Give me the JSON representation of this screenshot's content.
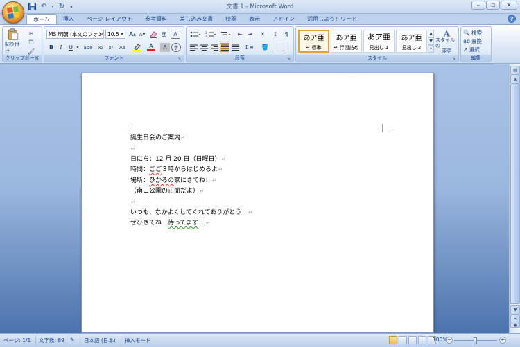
{
  "window": {
    "title": "文書 1 - Microsoft Word"
  },
  "quick_access": {
    "icons": [
      "save-icon",
      "undo-icon",
      "redo-icon",
      "customize-icon"
    ]
  },
  "tabs": [
    {
      "label": "ホーム",
      "active": true
    },
    {
      "label": "挿入"
    },
    {
      "label": "ページ レイアウト"
    },
    {
      "label": "参考資料"
    },
    {
      "label": "差し込み文書"
    },
    {
      "label": "校閲"
    },
    {
      "label": "表示"
    },
    {
      "label": "アドイン"
    },
    {
      "label": "活用しよう！ワード"
    }
  ],
  "ribbon": {
    "clipboard": {
      "label": "クリップボード",
      "paste_label": "貼り付け"
    },
    "font": {
      "label": "フォント",
      "font_name": "MS 明朝 (本文のフォン",
      "font_size": "10.5",
      "bold": "B",
      "italic": "I",
      "underline": "U",
      "strike": "abe",
      "subscript": "x₂",
      "superscript": "x²",
      "change_case": "Aa",
      "font_color": "A",
      "char_shading": "A",
      "grow": "A",
      "shrink": "A",
      "phonetic": "亜",
      "enclose": "A",
      "clear": "字"
    },
    "paragraph": {
      "label": "段落"
    },
    "styles": {
      "label": "スタイル",
      "items": [
        {
          "preview": "あア亜",
          "name": "↵ 標準"
        },
        {
          "preview": "あア亜",
          "name": "↵ 行間詰め"
        },
        {
          "preview": "あア亜",
          "name": "見出し 1"
        },
        {
          "preview": "あア亜",
          "name": "見出し 2"
        }
      ],
      "change_label_1": "スタイルの",
      "change_label_2": "変更"
    },
    "editing": {
      "label": "編集",
      "find": "検索",
      "replace": "置換",
      "select": "選択"
    }
  },
  "document": {
    "lines": [
      {
        "text": "誕生日会のご案内",
        "mark": "↵"
      },
      {
        "text": "",
        "mark": "↵"
      },
      {
        "text": "日にち：12 月 20 日（日曜日）",
        "mark": "↵"
      },
      {
        "pre": "時間：",
        "squiggle": "ごご",
        "post": "３時からはじめるよ",
        "mark": "↵"
      },
      {
        "pre": "場所：",
        "squiggle": "ひかるの",
        "post": "家にきてね！",
        "mark": "↵"
      },
      {
        "text": "（南口公園の正面だよ）",
        "mark": "↵"
      },
      {
        "text": "",
        "mark": "↵"
      },
      {
        "text": "いつも、なかよくしてくれてありがとう！",
        "mark": "↵"
      },
      {
        "pre": "ぜひきてね　",
        "green": "待ってます",
        "post": "！",
        "mark": "↵"
      }
    ]
  },
  "statusbar": {
    "page": "ページ: 1/1",
    "words": "文字数: 89",
    "language": "日本語 (日本)",
    "mode": "挿入モード",
    "zoom": "100%"
  },
  "colors": {
    "accent": "#15428b",
    "ribbon_bg": "#dfe9f6",
    "doc_bg": "#9bb8df",
    "red_squiggle": "#e03030",
    "green_squiggle": "#2aa02a"
  }
}
